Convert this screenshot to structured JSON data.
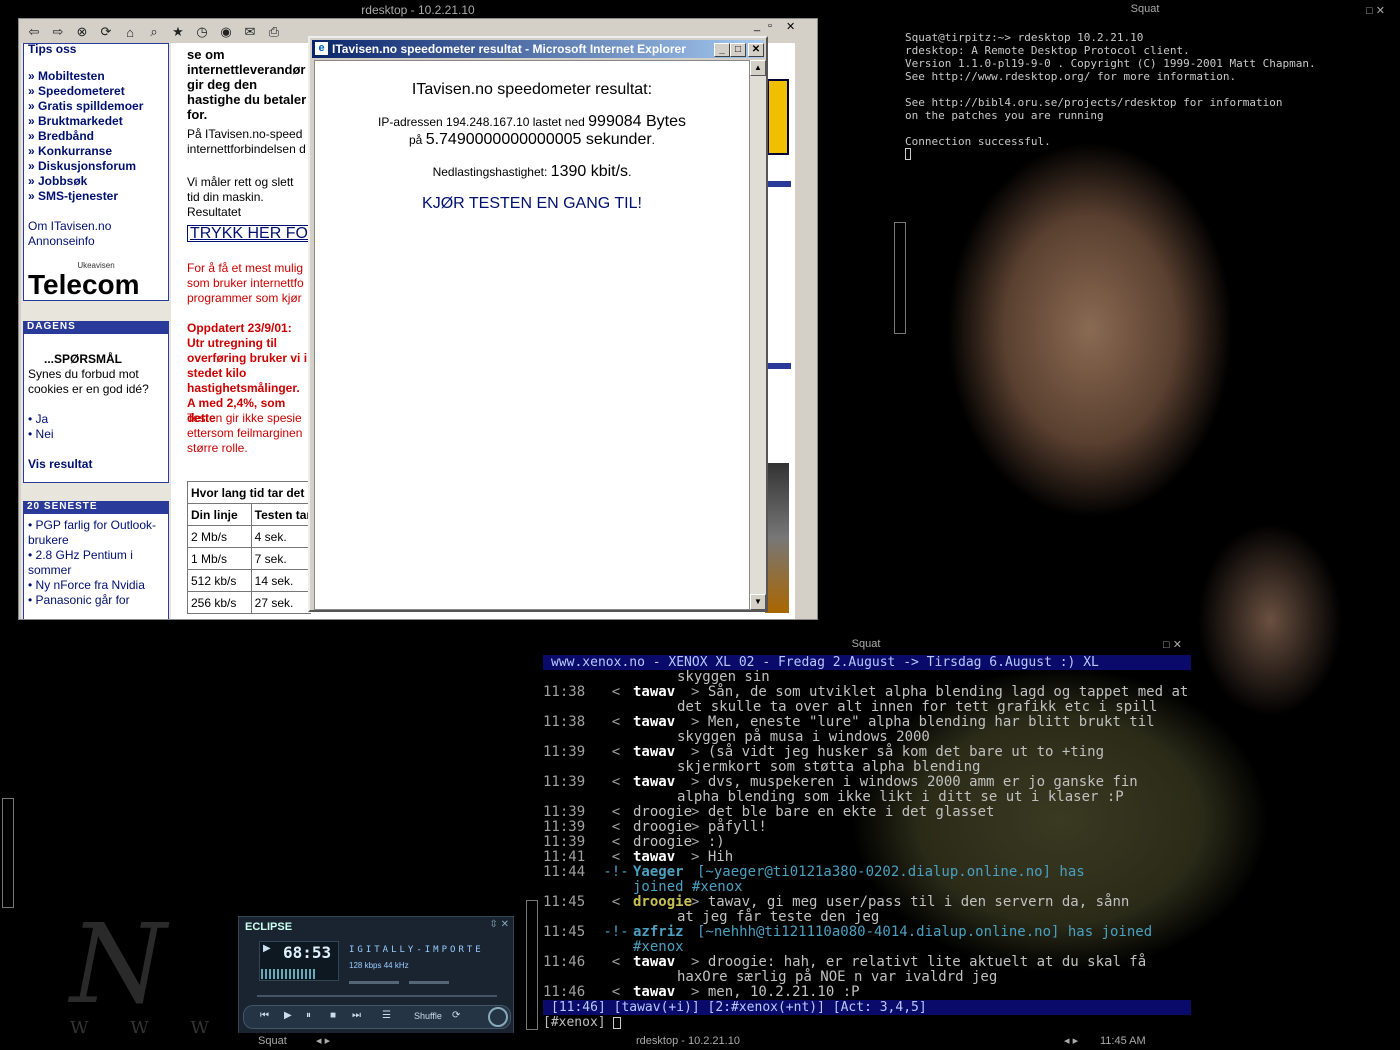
{
  "rdesktop": {
    "title": "rdesktop - 10.2.21.10"
  },
  "ie": {
    "left_column": {
      "tips_label": "Tips oss",
      "nav_links": [
        "» Mobiltesten",
        "» Speedometeret",
        "» Gratis spilldemoer",
        "» Bruktmarkedet",
        "» Bredbånd",
        "» Konkurranse",
        "» Diskusjonsforum",
        "» Jobbsøk",
        "» SMS-tjenester"
      ],
      "about_links": [
        "Om ITavisen.no",
        "Annonseinfo"
      ],
      "logo_small": "Ukeavisen",
      "logo_big": "Telecom",
      "dagens_header": "DAGENS",
      "poll_title": "...SPØRSMÅL",
      "poll_question": "Synes du forbud mot cookies er en god idé?",
      "poll_options": [
        "• Ja",
        "• Nei"
      ],
      "poll_results": "Vis resultat",
      "recent_header": "20 SENESTE",
      "recent_links": [
        "• PGP farlig for Outlook-brukere",
        "• 2.8 GHz Pentium i sommer",
        "• Ny nForce fra Nvidia",
        "• Panasonic går for"
      ]
    },
    "middle": {
      "intro": "se om internettleverandør gir deg den hastighe du betaler for.",
      "p1": "På ITavisen.no-speed internettforbindelsen d",
      "p2": "Vi måler rett og slett tid din maskin. Resultatet",
      "cta": "TRYKK HER FOR",
      "red1": "For å få et mest mulig som bruker internettfo programmer som kjør",
      "red_bold": "Oppdatert 23/9/01: Utr utregning til overføring bruker vi i stedet kilo hastighetsmålinger. A med 2,4%, som dette",
      "red2": "Testen gir ikke spesie ettersom feilmarginen større rolle.",
      "table_caption": "Hvor lang tid tar det å",
      "table_headers": [
        "Din linje",
        "Testen tar"
      ],
      "table_rows": [
        [
          "2 Mb/s",
          "4 sek."
        ],
        [
          "1 Mb/s",
          "7 sek."
        ],
        [
          "512 kb/s",
          "14 sek."
        ],
        [
          "256 kb/s",
          "27 sek."
        ]
      ]
    }
  },
  "popup": {
    "title": "ITavisen.no speedometer resultat - Microsoft Internet Explorer",
    "heading": "ITavisen.no speedometer resultat:",
    "ip_prefix": "IP-adressen 194.248.167.10 lastet ned",
    "bytes": "999084 Bytes",
    "time_prefix": "på",
    "seconds": "5.7490000000000005 sekunder",
    "speed_label": "Nedlastingshastighet:",
    "speed_value": "1390 kbit/s",
    "retest": "KJØR TESTEN EN GANG TIL!"
  },
  "term1": {
    "title": "Squat",
    "lines": [
      "Squat@tirpitz:~> rdesktop 10.2.21.10",
      "rdesktop: A Remote Desktop Protocol client.",
      "Version 1.1.0-pl19-9-0 . Copyright (C) 1999-2001 Matt Chapman.",
      "See http://www.rdesktop.org/ for more information.",
      "",
      "See http://bibl4.oru.se/projects/rdesktop for information",
      "on the patches you are running",
      "",
      "Connection successful."
    ]
  },
  "irc": {
    "title": "Squat",
    "topic": "www.xenox.no - XENOX XL 02 - Fredag 2.August -> Tirsdag 6.August :) XL",
    "status": "[11:46] [tawav(+i)] [2:#xenox(+nt)] [Act: 3,4,5]",
    "input": "[#xenox] ",
    "log": [
      {
        "ts": "",
        "sep": "",
        "nick": "",
        "text": "skyggen sin",
        "cont": true
      },
      {
        "ts": "11:38",
        "sep": "<",
        "nick": "tawav",
        "text": "Sån, de som utviklet alpha blending lagd og tappet med at"
      },
      {
        "ts": "",
        "sep": "",
        "nick": "",
        "text": "det skulle ta over alt innen for tett grafikk etc i spill",
        "cont": true
      },
      {
        "ts": "11:38",
        "sep": "<",
        "nick": "tawav",
        "text": "Men, eneste \"lure\" alpha blending har blitt brukt til"
      },
      {
        "ts": "",
        "sep": "",
        "nick": "",
        "text": "skyggen på musa i windows 2000",
        "cont": true
      },
      {
        "ts": "11:39",
        "sep": "<",
        "nick": "tawav",
        "text": "(så vidt jeg husker så kom det bare ut to +ting"
      },
      {
        "ts": "",
        "sep": "",
        "nick": "",
        "text": "skjermkort som støtta alpha blending",
        "cont": true
      },
      {
        "ts": "11:39",
        "sep": "<",
        "nick": "tawav",
        "text": "dvs, muspekeren i windows 2000 amm er jo ganske fin"
      },
      {
        "ts": "",
        "sep": "",
        "nick": "",
        "text": "alpha blending som ikke likt i ditt se ut i klaser :P",
        "cont": true
      },
      {
        "ts": "11:39",
        "sep": "<",
        "nick": "droogie",
        "text": "det ble bare en ekte i det glasset",
        "n2": true
      },
      {
        "ts": "11:39",
        "sep": "<",
        "nick": "droogie",
        "text": "påfyll!",
        "n2": true
      },
      {
        "ts": "11:39",
        "sep": "<",
        "nick": "droogie",
        "text": ":)",
        "n2": true
      },
      {
        "ts": "11:41",
        "sep": "<",
        "nick": "tawav",
        "text": "Hih"
      },
      {
        "ts": "11:44",
        "sep": "-!-",
        "nick": "Yaeger",
        "text": "[~yaeger@ti0121a380-0202.dialup.online.no] has",
        "join": true
      },
      {
        "ts": "",
        "sep": "",
        "nick": "",
        "text": "joined #xenox",
        "joincont": true
      },
      {
        "ts": "11:45",
        "sep": "<",
        "nick": "droogie",
        "text": "tawav, gi meg user/pass til i den servern da, sånn",
        "yellow": true
      },
      {
        "ts": "",
        "sep": "",
        "nick": "",
        "text": "at jeg får teste den jeg",
        "cont": true
      },
      {
        "ts": "11:45",
        "sep": "-!-",
        "nick": "azfriz",
        "text": "[~nehhh@ti121110a080-4014.dialup.online.no] has joined",
        "join": true
      },
      {
        "ts": "",
        "sep": "",
        "nick": "",
        "text": "#xenox",
        "joincont": true
      },
      {
        "ts": "11:46",
        "sep": "<",
        "nick": "tawav",
        "text": "droogie: hah, er relativt lite aktuelt at du skal få"
      },
      {
        "ts": "",
        "sep": "",
        "nick": "",
        "text": "haxOre særlig på NOE n var ivaldrd jeg",
        "cont": true
      },
      {
        "ts": "11:46",
        "sep": "<",
        "nick": "tawav",
        "text": "men, 10.2.21.10 :P"
      }
    ]
  },
  "player": {
    "brand": "ECLIPSE",
    "time": "68:53",
    "marquee": "IGITALLY-IMPORTE",
    "kbps": "128 kbps 44 kHz",
    "shuffle": "Shuffle"
  },
  "taskbar": {
    "left": "Squat",
    "center": "rdesktop - 10.2.21.10",
    "clock": "11:45 AM"
  },
  "wallpaper": {
    "script": "N",
    "url": "W W W . D E"
  }
}
